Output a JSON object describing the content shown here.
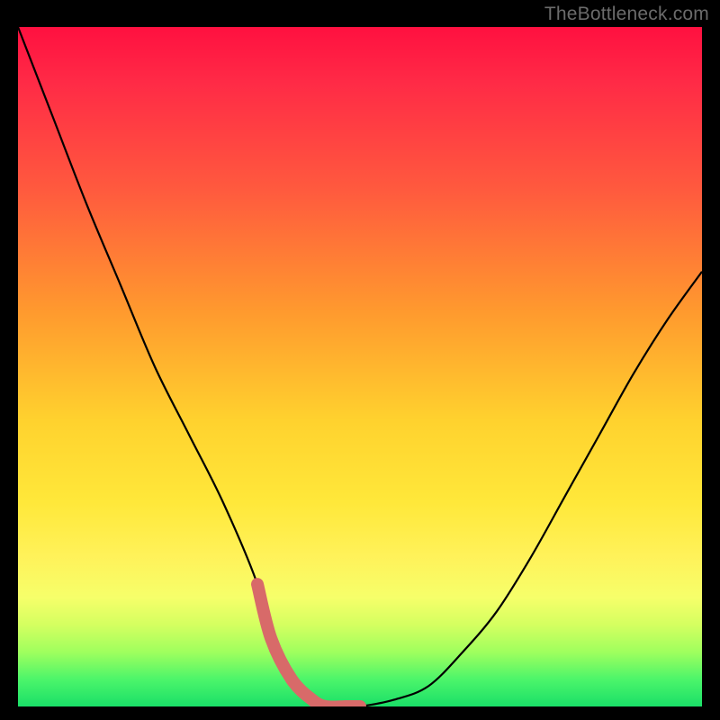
{
  "watermark": "TheBottleneck.com",
  "colors": {
    "frame": "#000000",
    "gradient_top": "#ff1040",
    "gradient_bottom": "#1adf68",
    "curve": "#000000",
    "highlight": "#d86a69"
  },
  "chart_data": {
    "type": "line",
    "title": "",
    "xlabel": "",
    "ylabel": "",
    "xlim": [
      0,
      100
    ],
    "ylim": [
      0,
      100
    ],
    "x": [
      0,
      5,
      10,
      15,
      20,
      25,
      30,
      35,
      37,
      40,
      43,
      45,
      48,
      50,
      55,
      60,
      65,
      70,
      75,
      80,
      85,
      90,
      95,
      100
    ],
    "values": [
      100,
      87,
      74,
      62,
      50,
      40,
      30,
      18,
      10,
      4,
      1,
      0,
      0,
      0,
      1,
      3,
      8,
      14,
      22,
      31,
      40,
      49,
      57,
      64
    ],
    "highlight_range_x": [
      35,
      50
    ],
    "annotations": []
  }
}
